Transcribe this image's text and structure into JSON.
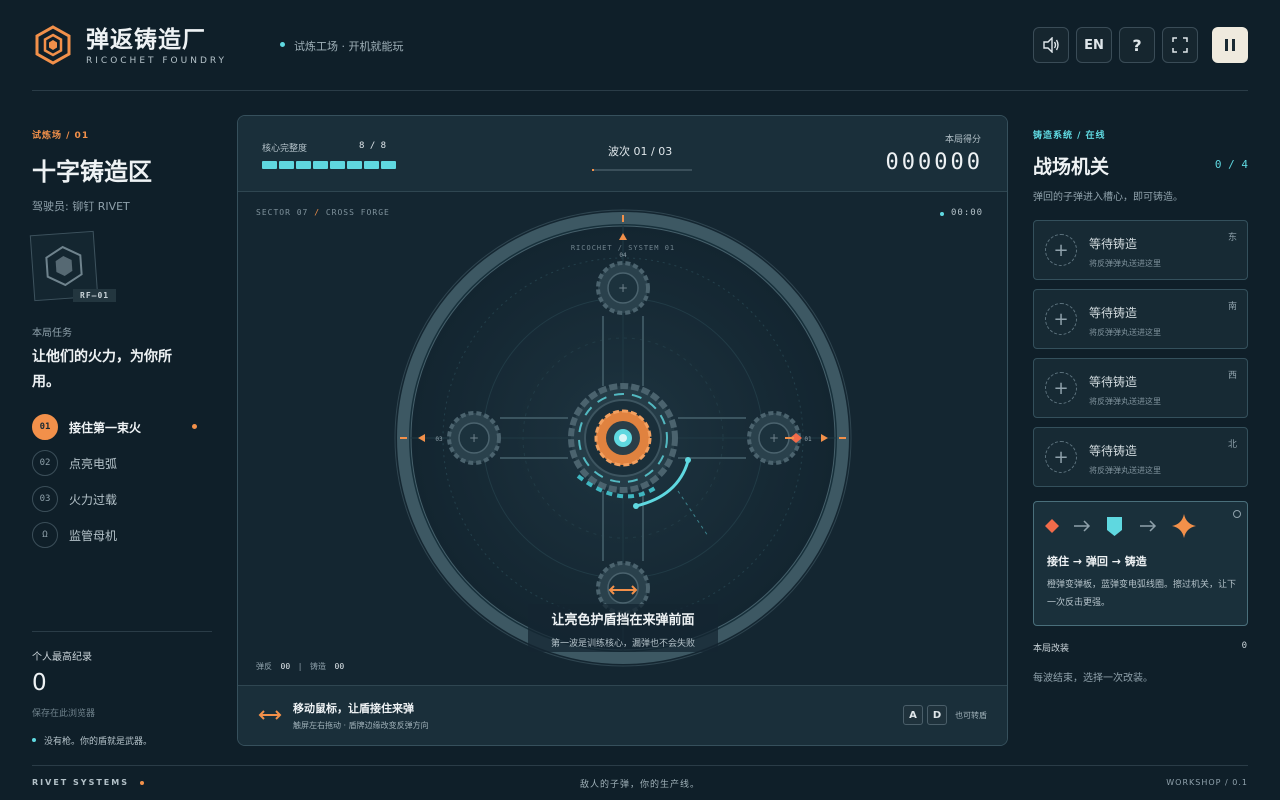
{
  "header": {
    "title": "弹返铸造厂",
    "subtitle": "RICOCHET FOUNDRY",
    "tagline": "试炼工场 · 开机就能玩",
    "lang_label": "EN",
    "help_label": "?"
  },
  "left": {
    "arena_tag": "试炼场 / 01",
    "arena_title": "十字铸造区",
    "pilot": "驾驶员: 铆钉 RIVET",
    "badge_label": "RF—01",
    "mission_label": "本局任务",
    "mission_text": "让他们的火力，为你所用。",
    "tasks": [
      {
        "num": "01",
        "label": "接住第一束火"
      },
      {
        "num": "02",
        "label": "点亮电弧"
      },
      {
        "num": "03",
        "label": "火力过载"
      },
      {
        "num": "Ω",
        "label": "监管母机"
      }
    ],
    "record_label": "个人最高纪录",
    "record_value": "0",
    "record_note": "保存在此浏览器",
    "hint": "没有枪。你的盾就是武器。"
  },
  "game": {
    "integrity_label": "核心完整度",
    "integrity_value": "8 / 8",
    "integrity_segments": 8,
    "wave_label": "波次 01 / 03",
    "wave_progress": 0.02,
    "score_label": "本局得分",
    "score_value": "000000",
    "sector_label": "SECTOR 07",
    "sector_sep": "/",
    "sector_name": "CROSS FORGE",
    "timer": "00:00",
    "ring_label": "RICOCHET / SYSTEM 01",
    "node_labels": {
      "north": "04",
      "west": "03",
      "east": "01"
    },
    "overlay_title": "让亮色护盾挡在来弹前面",
    "overlay_sub": "第一波是训练核心，漏弹也不会失败",
    "deflect_label": "弹反",
    "deflect_value": "00",
    "forge_label": "铸造",
    "forge_value": "00",
    "instr_title": "移动鼠标，让盾接住来弹",
    "instr_sub": "触屏左右拖动 · 盾牌边缘改变反弹方向",
    "key_a": "A",
    "key_d": "D",
    "key_note": "也可转盾"
  },
  "right": {
    "system_tag": "铸造系统 / 在线",
    "title": "战场机关",
    "count": "0 / 4",
    "desc": "弹回的子弹进入槽心，即可铸造。",
    "slots": [
      {
        "title": "等待铸造",
        "sub": "将反弹弹丸送进这里",
        "dir": "东"
      },
      {
        "title": "等待铸造",
        "sub": "将反弹弹丸送进这里",
        "dir": "南"
      },
      {
        "title": "等待铸造",
        "sub": "将反弹弹丸送进这里",
        "dir": "西"
      },
      {
        "title": "等待铸造",
        "sub": "将反弹弹丸送进这里",
        "dir": "北"
      }
    ],
    "flow_title": "接住 → 弹回 → 铸造",
    "flow_desc": "橙弹变弹板，蓝弹变电弧线圈。擦过机关，让下一次反击更强。",
    "mods_label": "本局改装",
    "mods_value": "0",
    "mods_note": "每波结束，选择一次改装。"
  },
  "footer": {
    "left": "RIVET SYSTEMS",
    "center": "敌人的子弹，你的生产线。",
    "right": "WORKSHOP / 0.1"
  },
  "colors": {
    "accent": "#f2904a",
    "cyan": "#5fd8e0",
    "background": "#0f1f29",
    "panel": "#172a34"
  }
}
